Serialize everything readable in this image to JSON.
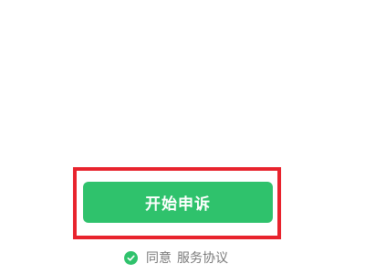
{
  "action": {
    "button_label": "开始申诉"
  },
  "agreement": {
    "checked": true,
    "agree_label": "同意",
    "link_label": "服务协议"
  },
  "colors": {
    "accent": "#2fc26c",
    "highlight": "#e8232d",
    "muted_text": "#7a7a7a"
  },
  "icons": {
    "checkbox": "check-circle-icon"
  }
}
